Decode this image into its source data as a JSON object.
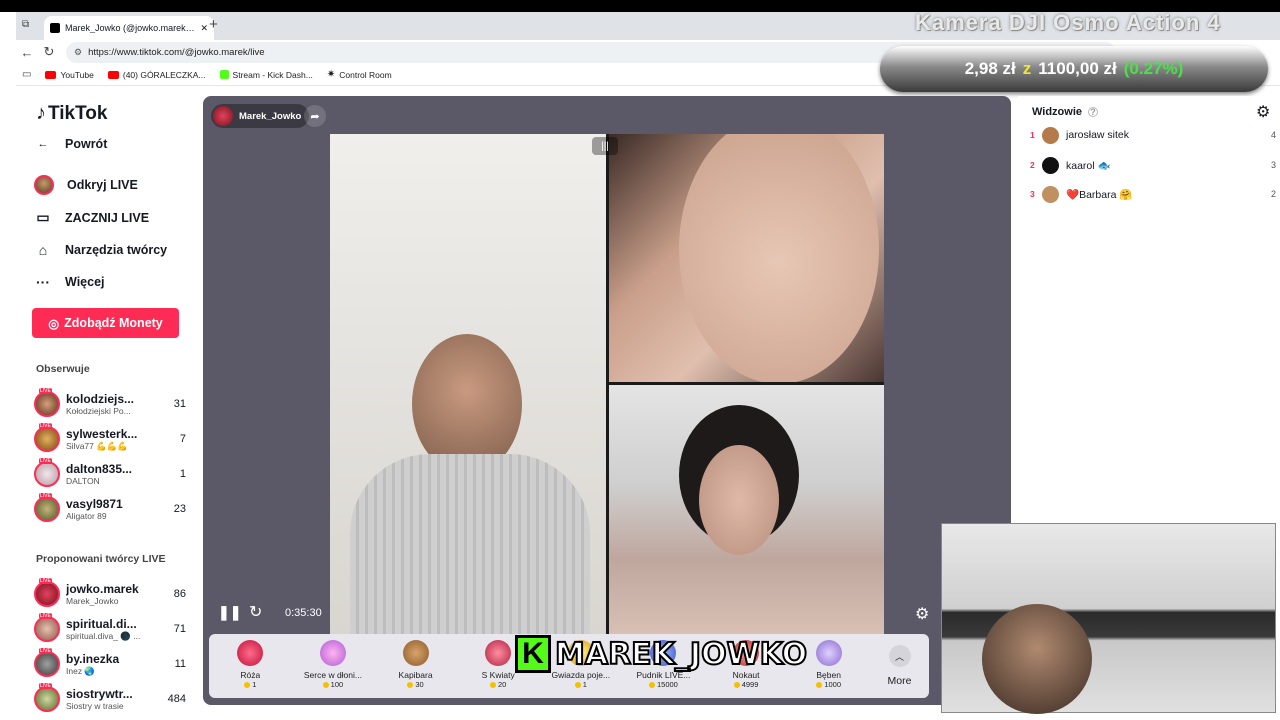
{
  "overlay": {
    "camera_title": "Kamera DJI Osmo Action 4",
    "price_current": "2,98 zł",
    "price_sep": "z",
    "price_target": "1100,00 zł",
    "price_pct": "(0.27%)"
  },
  "browser": {
    "tab_title": "Marek_Jowko (@jowko.marek) pr...",
    "tab_close": "✕",
    "new_tab": "+",
    "url": "https://www.tiktok.com/@jowko.marek/live",
    "bookmarks": [
      {
        "label": "YouTube",
        "color": "#ff0000"
      },
      {
        "label": "(40) GÓRALECZKA...",
        "color": "#ff0000"
      },
      {
        "label": "Stream - Kick Dash...",
        "color": "#53fc18"
      },
      {
        "label": "Control Room",
        "color": "#333333"
      }
    ]
  },
  "sidebar": {
    "logo": "TikTok",
    "menu": {
      "back": "Powrót",
      "discover": "Odkryj LIVE",
      "start": "ZACZNIJ LIVE",
      "tools": "Narzędzia twórcy",
      "more": "Więcej"
    },
    "coins_button": "Zdobądź Monety",
    "following_title": "Obserwuje",
    "following": [
      {
        "name": "kolodziejs...",
        "sub": "Kołodziejski Po...",
        "count": "31"
      },
      {
        "name": "sylwesterk...",
        "sub": "Silva77 💪💪💪",
        "count": "7"
      },
      {
        "name": "dalton835...",
        "sub": "DALTON",
        "count": "1"
      },
      {
        "name": "vasyl9871",
        "sub": "Aligator 89",
        "count": "23"
      }
    ],
    "suggested_title": "Proponowani twórcy LIVE",
    "suggested": [
      {
        "name": "jowko.marek",
        "sub": "Marek_Jowko",
        "count": "86"
      },
      {
        "name": "spiritual.di...",
        "sub": "spiritual.diva_ 🌑 ...",
        "count": "71"
      },
      {
        "name": "by.inezka",
        "sub": "Inez 🌏",
        "count": "11"
      },
      {
        "name": "siostrywtr...",
        "sub": "Siostry w trasie",
        "count": "484"
      }
    ]
  },
  "stream": {
    "host": "Marek_Jowko",
    "time": "0:35:30",
    "gifts": [
      {
        "name": "Róża",
        "price": "1",
        "color": "#e0245e"
      },
      {
        "name": "Serce w dłoni...",
        "price": "100",
        "color": "#e889d8"
      },
      {
        "name": "Kapibara",
        "price": "30",
        "color": "#a8743d"
      },
      {
        "name": "S Kwiaty",
        "price": "20",
        "color": "#d63b55"
      },
      {
        "name": "Gwiazda poje...",
        "price": "1",
        "color": "#f3c93a"
      },
      {
        "name": "Pudnik LIVE...",
        "price": "15000",
        "color": "#5a7be0"
      },
      {
        "name": "Nokaut",
        "price": "4999",
        "color": "#c44"
      },
      {
        "name": "Bęben",
        "price": "1000",
        "color": "#a58be0"
      }
    ],
    "more": "More"
  },
  "name_tag": {
    "k": "K",
    "text": "MAREK_JOWKO"
  },
  "viewers": {
    "title": "Widzowie",
    "list": [
      {
        "rank": "1",
        "name": "jarosław sitek",
        "num": "4",
        "color": "#b47a4a"
      },
      {
        "rank": "2",
        "name": "kaarol 🐟",
        "num": "3",
        "color": "#111111"
      },
      {
        "rank": "3",
        "name": "❤️Barbara 🤗",
        "num": "2",
        "color": "#c09060"
      }
    ]
  }
}
